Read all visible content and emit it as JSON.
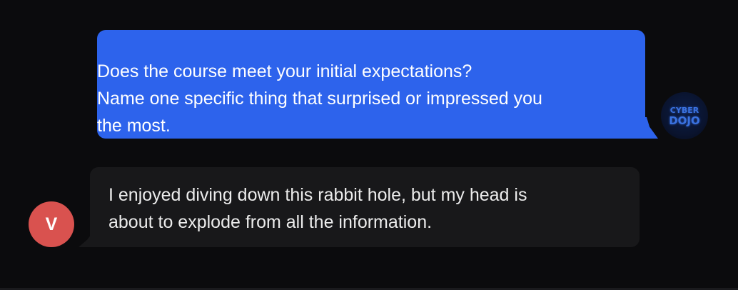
{
  "messages": [
    {
      "sender": "bot",
      "avatar": {
        "icon": "cyber-dojo-logo",
        "line1": "CYBER",
        "line2": "DOJO"
      },
      "lines": [
        "Does the course meet your initial expectations?",
        "Name one specific thing that surprised or impressed you",
        "the most."
      ],
      "bubble_color": "#2d63ec"
    },
    {
      "sender": "user",
      "avatar": {
        "initial": "V",
        "color": "#d9524f"
      },
      "lines": [
        "I enjoyed diving down this rabbit hole, but my head is",
        "about to explode from all the information."
      ],
      "bubble_color": "#18181a"
    }
  ]
}
